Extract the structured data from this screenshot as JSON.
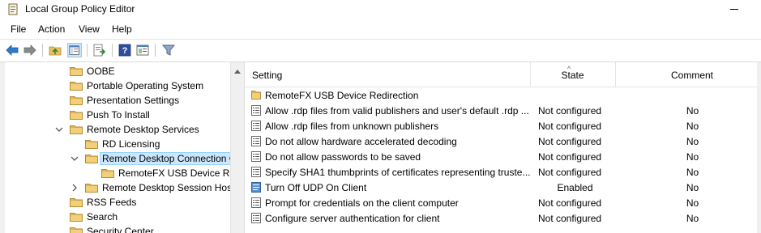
{
  "window": {
    "title": "Local Group Policy Editor"
  },
  "menu": [
    "File",
    "Action",
    "View",
    "Help"
  ],
  "toolbar": {
    "buttons": [
      {
        "icon": "back-arrow-icon"
      },
      {
        "icon": "forward-arrow-icon"
      },
      {
        "icon": "up-folder-icon"
      },
      {
        "icon": "show-hide-tree-icon"
      },
      {
        "icon": "export-list-icon"
      },
      {
        "icon": "help-icon"
      },
      {
        "icon": "properties-icon"
      },
      {
        "icon": "filter-icon"
      }
    ]
  },
  "tree": {
    "items": [
      {
        "label": "OOBE",
        "level": 0,
        "expander": "none"
      },
      {
        "label": "Portable Operating System",
        "level": 0,
        "expander": "none"
      },
      {
        "label": "Presentation Settings",
        "level": 0,
        "expander": "none"
      },
      {
        "label": "Push To Install",
        "level": 0,
        "expander": "none"
      },
      {
        "label": "Remote Desktop Services",
        "level": 0,
        "expander": "expanded"
      },
      {
        "label": "RD Licensing",
        "level": 1,
        "expander": "none"
      },
      {
        "label": "Remote Desktop Connection Client",
        "level": 1,
        "expander": "expanded",
        "selected": true
      },
      {
        "label": "RemoteFX USB Device Redirection",
        "level": 2,
        "expander": "none"
      },
      {
        "label": "Remote Desktop Session Host",
        "level": 1,
        "expander": "collapsed"
      },
      {
        "label": "RSS Feeds",
        "level": 0,
        "expander": "none"
      },
      {
        "label": "Search",
        "level": 0,
        "expander": "none"
      },
      {
        "label": "Security Center",
        "level": 0,
        "expander": "none"
      }
    ]
  },
  "list": {
    "columns": {
      "setting": "Setting",
      "state": "State",
      "comment": "Comment"
    },
    "rows": [
      {
        "type": "folder",
        "setting": "RemoteFX USB Device Redirection",
        "state": "",
        "comment": ""
      },
      {
        "type": "policy",
        "setting": "Allow .rdp files from valid publishers and user's default .rdp ...",
        "state": "Not configured",
        "comment": "No"
      },
      {
        "type": "policy",
        "setting": "Allow .rdp files from unknown publishers",
        "state": "Not configured",
        "comment": "No"
      },
      {
        "type": "policy",
        "setting": "Do not allow hardware accelerated decoding",
        "state": "Not configured",
        "comment": "No"
      },
      {
        "type": "policy",
        "setting": "Do not allow passwords to be saved",
        "state": "Not configured",
        "comment": "No"
      },
      {
        "type": "policy",
        "setting": "Specify SHA1 thumbprints of certificates representing truste...",
        "state": "Not configured",
        "comment": "No"
      },
      {
        "type": "policy-enabled",
        "setting": "Turn Off UDP On Client",
        "state": "Enabled",
        "comment": "No"
      },
      {
        "type": "policy",
        "setting": "Prompt for credentials on the client computer",
        "state": "Not configured",
        "comment": "No"
      },
      {
        "type": "policy",
        "setting": "Configure server authentication for client",
        "state": "Not configured",
        "comment": "No"
      }
    ]
  },
  "colors": {
    "folder": "#dcb35c",
    "selection": "#cce8ff",
    "selection_border": "#99d1ff"
  }
}
